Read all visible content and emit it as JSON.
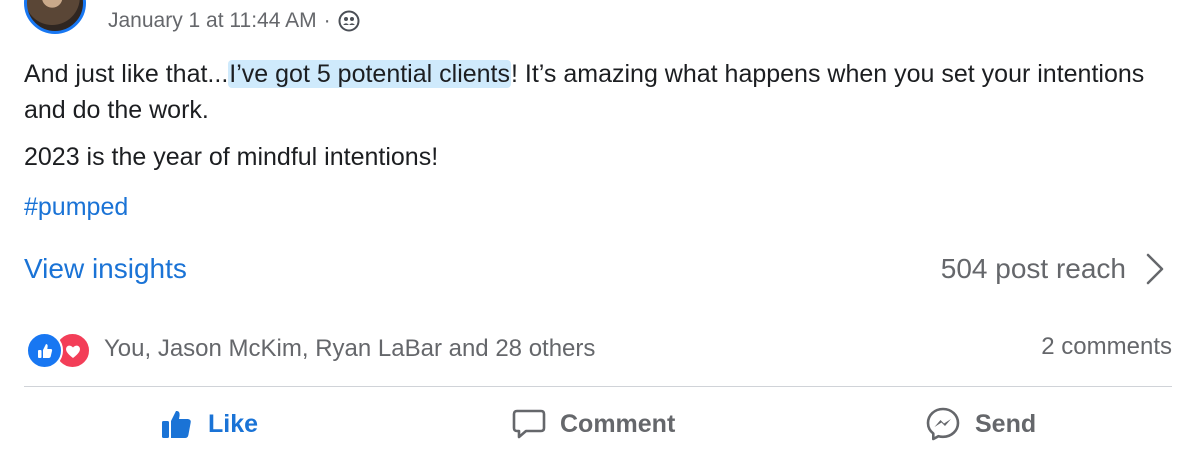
{
  "header": {
    "timestamp": "January 1 at 11:44 AM",
    "separator": "·",
    "privacy_icon": "friends-icon"
  },
  "post": {
    "line1_before": "And just like that...",
    "line1_highlight": "I’ve got 5 potential clients",
    "line1_after": "! It’s amazing what happens when you set your intentions and do the work.",
    "line2": "2023 is the year of mindful intentions!",
    "hashtag": "#pumped"
  },
  "insights": {
    "view_label": "View insights",
    "reach": "504 post reach"
  },
  "engagement": {
    "reaction_icons": [
      "like-icon",
      "love-icon"
    ],
    "reactors": "You, Jason McKim, Ryan LaBar and 28 others",
    "comments": "2 comments"
  },
  "actions": {
    "like": "Like",
    "comment": "Comment",
    "send": "Send"
  },
  "colors": {
    "accent": "#1a73d6",
    "highlight": "#cfeafc",
    "secondary_text": "#65676b",
    "love": "#f33e58"
  }
}
